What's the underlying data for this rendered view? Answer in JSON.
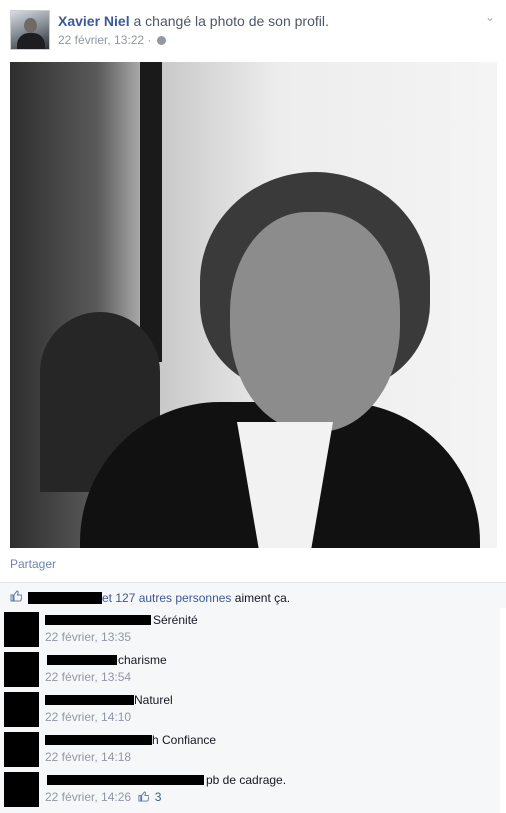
{
  "post": {
    "author": "Xavier Niel",
    "action": "a changé la photo de son profil.",
    "timestamp": "22 février, 13:22",
    "separator": "·",
    "privacy_icon": "globe-icon",
    "options_icon": "chevron-down-icon"
  },
  "actions": {
    "share_label": "Partager"
  },
  "likes": {
    "text": "et 127 autres personnes",
    "suffix": "aiment ça."
  },
  "comments": [
    {
      "text": "Sérénité",
      "time": "22 février, 13:35"
    },
    {
      "text": "charisme",
      "time": "22 février, 13:54"
    },
    {
      "text": "Naturel",
      "time": "22 février, 14:10"
    },
    {
      "text": "h Confiance",
      "time": "22 février, 14:18"
    },
    {
      "text": "pb de cadrage.",
      "time": "22 février, 14:26",
      "likes": "3"
    }
  ],
  "colors": {
    "link": "#3b5998",
    "muted": "#9197a3",
    "panel": "#f6f7f8"
  }
}
